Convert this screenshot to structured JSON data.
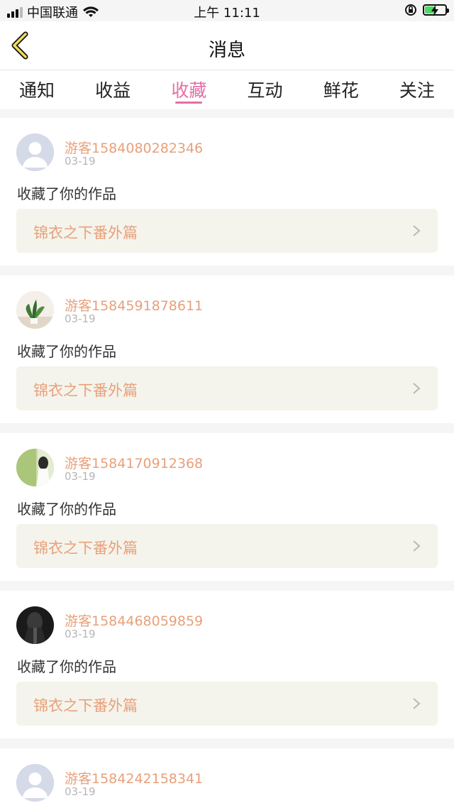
{
  "status_bar": {
    "carrier": "中国联通",
    "time": "上午 11:11",
    "battery_color": "#4cd964"
  },
  "nav": {
    "title": "消息",
    "back_icon": "chevron-left-icon"
  },
  "tabs": [
    {
      "label": "通知",
      "active": false
    },
    {
      "label": "收益",
      "active": false
    },
    {
      "label": "收藏",
      "active": true
    },
    {
      "label": "互动",
      "active": false
    },
    {
      "label": "鲜花",
      "active": false
    },
    {
      "label": "关注",
      "active": false
    }
  ],
  "accent_color": "#e46fa6",
  "messages": [
    {
      "user": "游客1584080282346",
      "date": "03-19",
      "action": "收藏了你的作品",
      "work": "锦衣之下番外篇",
      "avatar": "default-avatar"
    },
    {
      "user": "游客1584591878611",
      "date": "03-19",
      "action": "收藏了你的作品",
      "work": "锦衣之下番外篇",
      "avatar": "plant-photo-avatar"
    },
    {
      "user": "游客1584170912368",
      "date": "03-19",
      "action": "收藏了你的作品",
      "work": "锦衣之下番外篇",
      "avatar": "girl-photo-avatar"
    },
    {
      "user": "游客1584468059859",
      "date": "03-19",
      "action": "收藏了你的作品",
      "work": "锦衣之下番外篇",
      "avatar": "dark-photo-avatar"
    },
    {
      "user": "游客1584242158341",
      "date": "03-19",
      "avatar": "default-avatar"
    }
  ]
}
